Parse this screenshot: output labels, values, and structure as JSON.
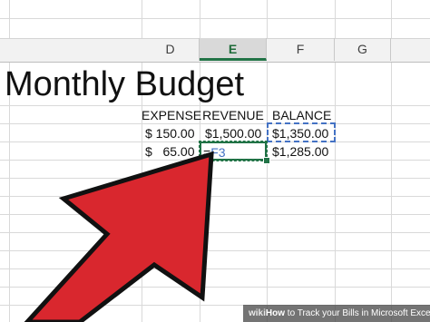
{
  "columns": [
    "D",
    "E",
    "F",
    "G"
  ],
  "title": "Monthly Budget",
  "headers": {
    "expense": "EXPENSE",
    "revenue": "REVENUE",
    "balance": "BALANCE"
  },
  "rows": [
    {
      "expense": "$ 150.00",
      "revenue": "$1,500.00",
      "balance": "$1,350.00"
    },
    {
      "expense": "$   65.00",
      "revenue_formula_prefix": "=",
      "revenue_formula_ref": "F3",
      "balance": "$1,285.00"
    }
  ],
  "colors": {
    "accent_green": "#217346",
    "reference_blue": "#4472c4",
    "arrow_red": "#d9272e"
  },
  "footer": {
    "wiki": "wiki",
    "how": "How",
    "text": " to Track your Bills in Microsoft Excel"
  }
}
